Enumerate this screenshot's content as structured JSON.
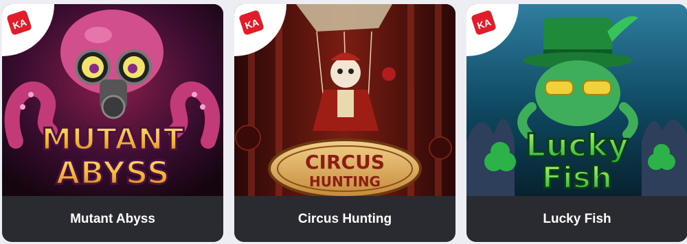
{
  "provider": {
    "logo_text": "KA",
    "icon": "dice-icon",
    "accent": "#e11d2a"
  },
  "games": [
    {
      "name": "Mutant Abyss",
      "logo_line1": "MUTANT",
      "logo_line2": "ABYSS",
      "theme": {
        "bg": "#2b0d2e",
        "accent": "#e85aa6",
        "logo": "#f3c64a"
      }
    },
    {
      "name": "Circus Hunting",
      "logo_line1": "CIRCUS",
      "logo_line2": "HUNTING",
      "theme": {
        "bg": "#3a0f0d",
        "accent": "#b8241c",
        "logo": "#d9a44b"
      }
    },
    {
      "name": "Lucky Fish",
      "logo_line1": "Lucky",
      "logo_line2": "Fish",
      "theme": {
        "bg": "#0b3a4e",
        "accent": "#2bb34a",
        "logo": "#3ee24a"
      }
    }
  ]
}
